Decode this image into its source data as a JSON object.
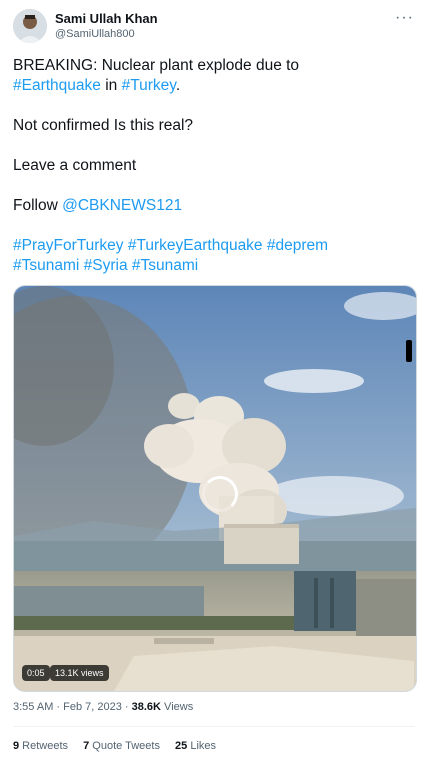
{
  "author": {
    "name": "Sami Ullah Khan",
    "handle": "@SamiUllah800"
  },
  "more_icon": "more-horizontal-icon",
  "post": {
    "line1": {
      "text": "BREAKING: Nuclear plant explode due to"
    },
    "line2": {
      "tag1": "#Earthquake",
      "mid": " in ",
      "tag2": "#Turkey",
      "end": "."
    },
    "line3": {
      "text": "Not confirmed Is this real?"
    },
    "line4": {
      "text": "Leave a comment"
    },
    "line5": {
      "prefix": "Follow ",
      "mention": "@CBKNEWS121"
    },
    "hashtags_row1": [
      "#PrayForTurkey",
      "#TurkeyEarthquake",
      "#deprem"
    ],
    "hashtags_row2": [
      "#Tsunami",
      "#Syria",
      "#Tsunami"
    ]
  },
  "video": {
    "duration": "0:05",
    "views": "13.1K views",
    "loading_icon": "loading-spinner-icon"
  },
  "meta": {
    "time": "3:55 AM",
    "sep1": " · ",
    "date": "Feb 7, 2023",
    "sep2": " · ",
    "views_count": "38.6K",
    "views_label": " Views"
  },
  "stats": {
    "retweets_count": "9",
    "retweets_label": " Retweets",
    "quotes_count": "7",
    "quotes_label": " Quote Tweets",
    "likes_count": "25",
    "likes_label": " Likes"
  },
  "colors": {
    "link": "#1d9bf0",
    "secondary": "#536471",
    "text": "#0f1419"
  }
}
